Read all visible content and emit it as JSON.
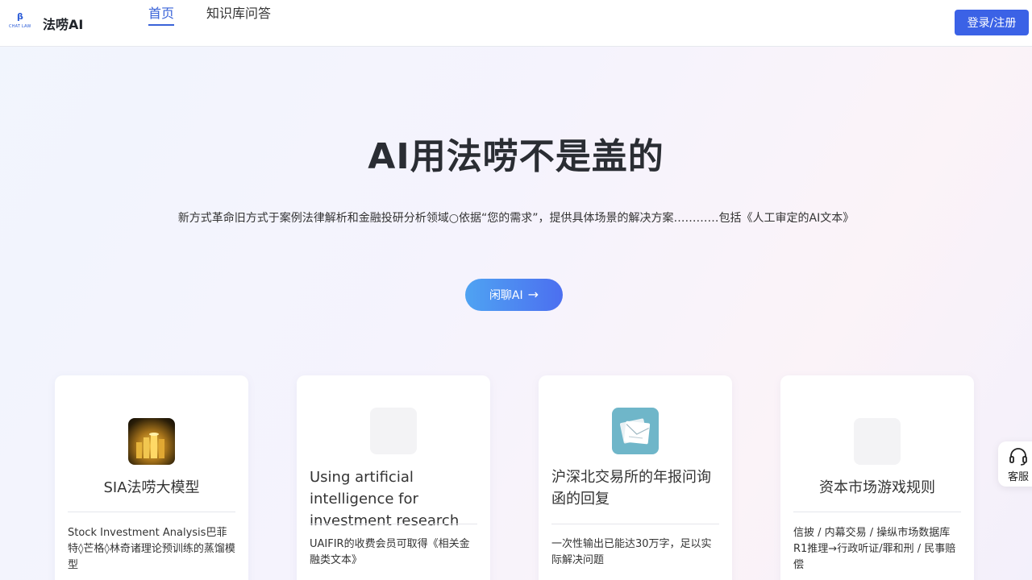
{
  "header": {
    "logo_glyph": "β",
    "logo_sub": "CHAT LAW",
    "brand": "法唠AI",
    "tabs": [
      {
        "label": "首页"
      },
      {
        "label": "知识库问答"
      }
    ],
    "login_label": "登录/注册"
  },
  "hero": {
    "title": "AI用法唠不是盖的",
    "description": "新方式革命旧方式于案例法律解析和金融投研分析领域○依据“您的需求”，提供具体场景的解决方案…………包括《人工审定的AI文本》",
    "chat_button": "闲聊AI",
    "chat_button_arrow": "→"
  },
  "cards": [
    {
      "title": "SIA法唠大模型",
      "description": "Stock Investment Analysis巴菲特◊芒格◊林奇诸理论预训练的蒸馏模型",
      "icon": "gold-coins-icon"
    },
    {
      "title": "Using artificial intelligence for investment research",
      "description": "UAIFIR的收费会员可取得《相关金融类文本》",
      "icon": "placeholder-icon"
    },
    {
      "title": "沪深北交易所的年报问询函的回复",
      "description": "一次性输出已能达30万字，足以实际解决问题",
      "icon": "letter-icon"
    },
    {
      "title": "资本市场游戏规则",
      "description": "信披 / 内幕交易 / 操纵市场数据库R1推理→行政听证/罪和刑 / 民事赔偿",
      "icon": "placeholder-icon"
    }
  ],
  "service": {
    "label": "客服",
    "icon": "headset-icon"
  },
  "colors": {
    "accent": "#3b62e6",
    "tab_active": "#3a63d8",
    "chat_gradient_start": "#4fa3f2",
    "chat_gradient_end": "#4c6ff0"
  }
}
